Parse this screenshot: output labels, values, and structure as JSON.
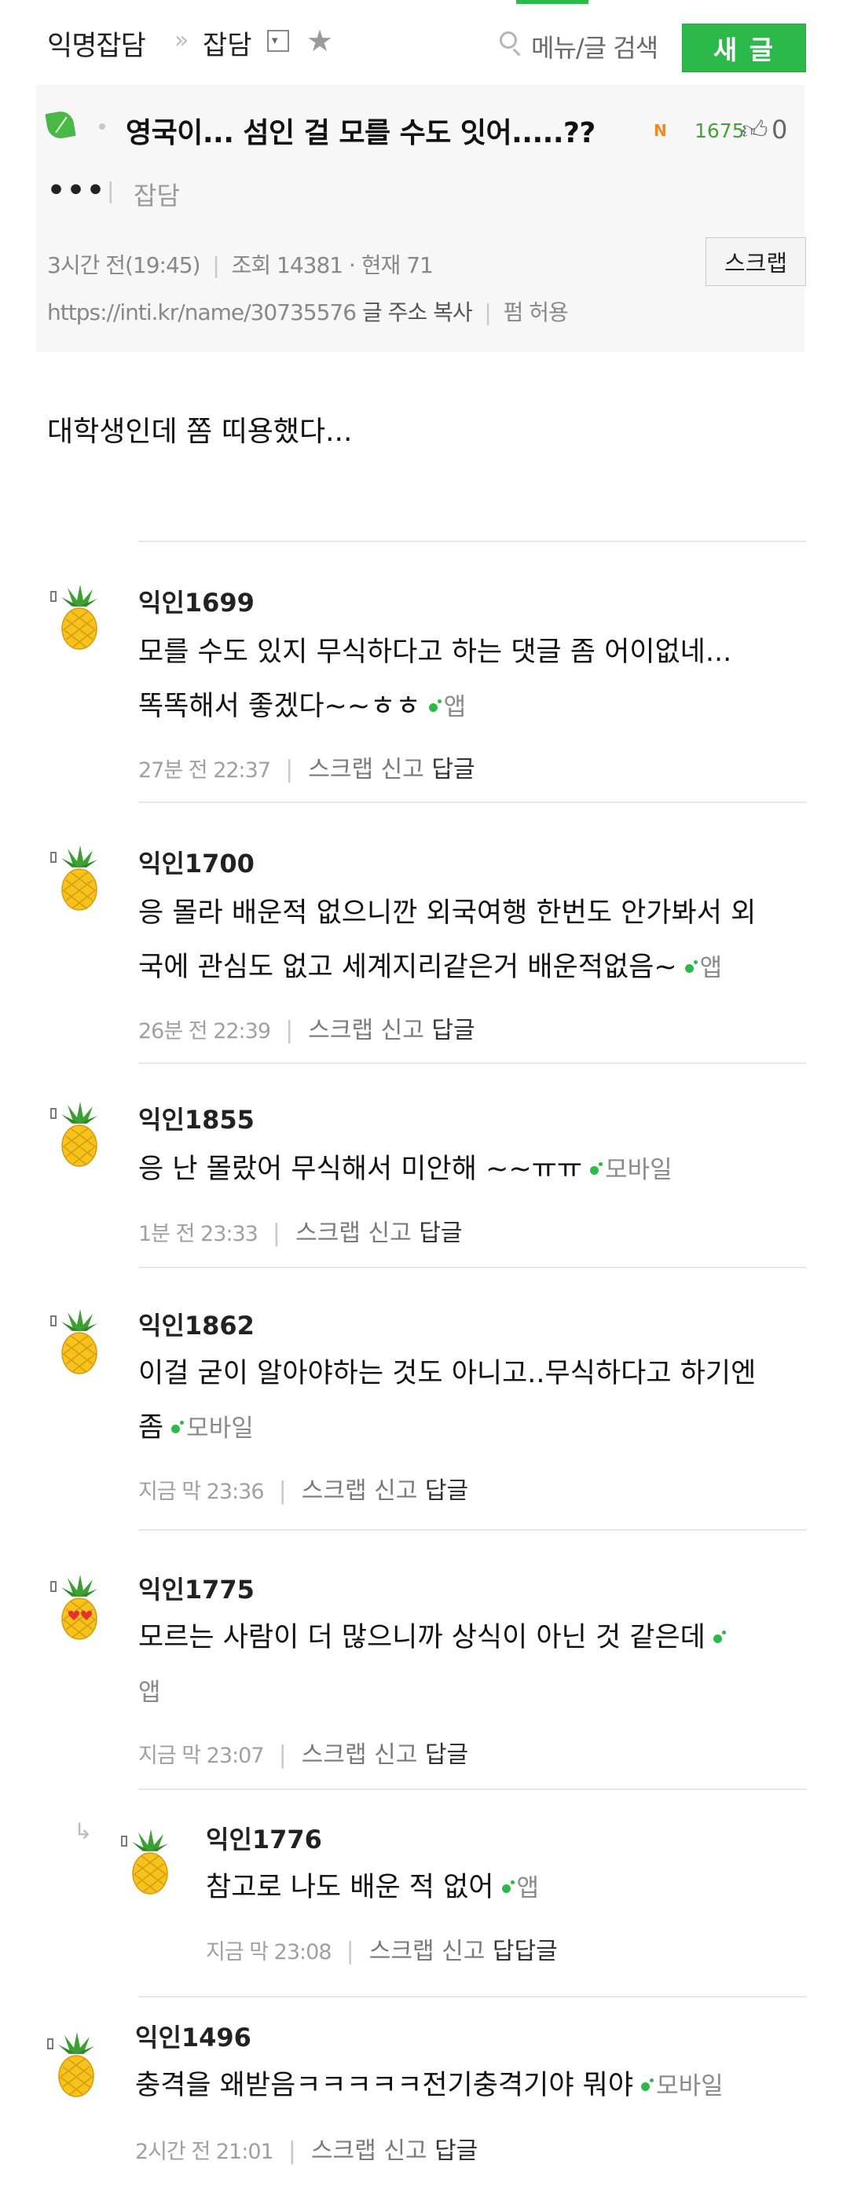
{
  "header": {
    "board": "익명잡담",
    "crumb_sep": "»",
    "sub_board": "잡담",
    "dropdown_icon": "▾",
    "star_icon": "★",
    "menu_search": "메뉴/글 검색",
    "new_post_label": "새 글"
  },
  "post": {
    "title": "영국이... 섬인 걸 모를 수도 잇어.....??",
    "new_badge": "N",
    "count": "1675",
    "likes": "0",
    "more": "•••",
    "category": "잡담",
    "time": "3시간 전(19:45)",
    "views": "조회 14381 · 현재 71",
    "scrap_label": "스크랩",
    "url": "https://inti.kr/name/30735576",
    "copy_label": "글 주소 복사",
    "permission": "펌 허용",
    "body": "대학생인데 쫌 띠용했다..."
  },
  "comments": [
    {
      "name": "익인1699",
      "lines": [
        "모를 수도 있지 무식하다고 하는 댓글 좀 어이없네...",
        "똑똑해서 좋겠다~~ㅎㅎ"
      ],
      "device": "앱",
      "date": "27분 전 22:37",
      "scrap": "스크랩",
      "report": "신고",
      "reply": "답글",
      "avatar": "pineapple"
    },
    {
      "name": "익인1700",
      "lines": [
        "응 몰라 배운적 없으니깐 외국여행 한번도 안가봐서 외",
        "국에 관심도 없고 세계지리같은거 배운적없음~"
      ],
      "device": "앱",
      "date": "26분 전 22:39",
      "scrap": "스크랩",
      "report": "신고",
      "reply": "답글",
      "avatar": "pineapple"
    },
    {
      "name": "익인1855",
      "lines": [
        "응 난 몰랐어 무식해서 미안해 ~~ㅠㅠ"
      ],
      "device": "모바일",
      "date": "1분 전 23:33",
      "scrap": "스크랩",
      "report": "신고",
      "reply": "답글",
      "avatar": "pineapple"
    },
    {
      "name": "익인1862",
      "lines": [
        "이걸 굳이 알아야하는 것도 아니고..무식하다고 하기엔",
        "좀"
      ],
      "device": "모바일",
      "date": "지금 막 23:36",
      "scrap": "스크랩",
      "report": "신고",
      "reply": "답글",
      "avatar": "pineapple"
    },
    {
      "name": "익인1775",
      "lines": [
        "모르는 사람이 더 많으니까 상식이 아닌 것 같은데",
        ""
      ],
      "device": "앱",
      "date": "지금 막 23:07",
      "scrap": "스크랩",
      "report": "신고",
      "reply": "답글",
      "avatar": "pineapple-hearts"
    },
    {
      "name": "익인1776",
      "lines": [
        "참고로 나도 배운 적 없어"
      ],
      "device": "앱",
      "date": "지금 막 23:08",
      "scrap": "스크랩",
      "report": "신고",
      "reply": "답답글",
      "avatar": "pineapple",
      "is_reply": true,
      "reply_arrow": "↳"
    },
    {
      "name": "익인1496",
      "lines": [
        "충격을 왜받음ㅋㅋㅋㅋㅋ전기충격기야 뭐야"
      ],
      "device": "모바일",
      "date": "2시간 전 21:01",
      "scrap": "스크랩",
      "report": "신고",
      "reply": "답글",
      "avatar": "pineapple"
    }
  ],
  "colors": {
    "accent": "#2db84a",
    "leaf": "#49b845",
    "new_badge": "#ef8a2a",
    "count": "#4a9d3c"
  }
}
